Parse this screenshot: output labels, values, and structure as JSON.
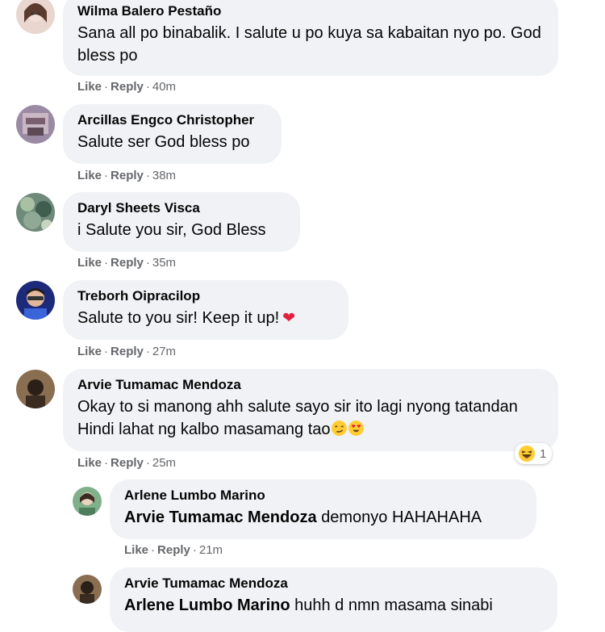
{
  "action_labels": {
    "like": "Like",
    "reply": "Reply",
    "separator": "·"
  },
  "comments": [
    {
      "author": "Wilma Balero Pestaño",
      "text": "Sana all po binabalik. I salute u po kuya sa kabaitan nyo po. God bless po",
      "time": "40m"
    },
    {
      "author": "Arcillas Engco Christopher",
      "text": "Salute ser God bless po",
      "time": "38m"
    },
    {
      "author": "Daryl Sheets Visca",
      "text": "i Salute you sir, God Bless",
      "time": "35m"
    },
    {
      "author": "Treborh Oipracilop",
      "text": "Salute to you sir! Keep it up!",
      "emoji": "❤",
      "time": "27m"
    },
    {
      "author": "Arvie Tumamac Mendoza",
      "text": "Okay to si manong ahh salute sayo sir ito lagi nyong tatandan Hindi lahat ng kalbo masamang tao",
      "time": "25m",
      "reaction_count": "1"
    }
  ],
  "replies": [
    {
      "author": "Arlene Lumbo Marino",
      "mention": "Arvie Tumamac Mendoza",
      "text": " demonyo HAHAHAHA",
      "time": "21m"
    },
    {
      "author": "Arvie Tumamac Mendoza",
      "mention": "Arlene Lumbo Marino",
      "text": " huhh d nmn masama sinabi"
    }
  ],
  "colors": {
    "bubble": "#f0f2f5",
    "meta": "#65676b",
    "heart": "#e41e3f"
  }
}
